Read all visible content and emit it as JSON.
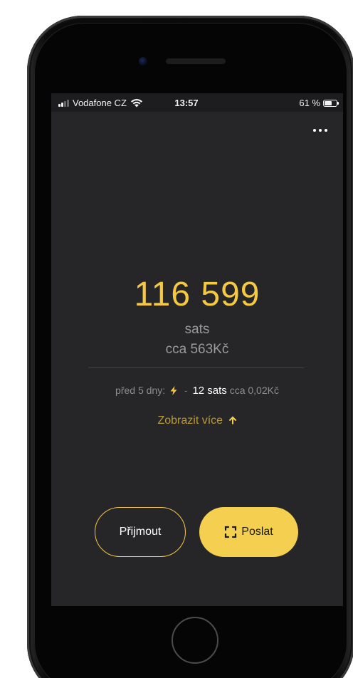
{
  "statusbar": {
    "carrier": "Vodafone CZ",
    "time": "13:57",
    "battery_text": "61 %",
    "battery_level": 0.61
  },
  "menu": {
    "icon": "more-horizontal-icon"
  },
  "wallet": {
    "balance": "116 599",
    "unit": "sats",
    "fiat": "cca 563Kč"
  },
  "last_transaction": {
    "when": "před 5 dny:",
    "type_icon": "lightning-bolt-icon",
    "sign": "-",
    "amount": "12 sats",
    "fiat": "cca 0,02Kč"
  },
  "show_more": {
    "label": "Zobrazit více",
    "icon": "arrow-up-icon"
  },
  "actions": {
    "receive_label": "Přijmout",
    "send_label": "Poslat",
    "send_icon": "scan-icon"
  },
  "colors": {
    "accent": "#f5c842",
    "background": "#262629",
    "negative": "#e0405a"
  }
}
